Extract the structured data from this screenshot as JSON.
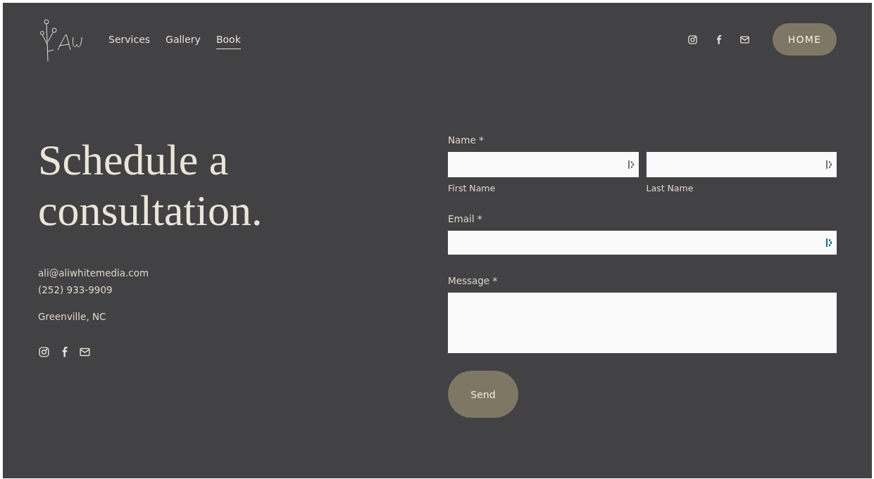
{
  "header": {
    "nav": [
      {
        "label": "Services",
        "selected": false
      },
      {
        "label": "Gallery",
        "selected": false
      },
      {
        "label": "Book",
        "selected": true
      }
    ],
    "social": [
      {
        "kind": "instagram"
      },
      {
        "kind": "facebook"
      },
      {
        "kind": "email"
      }
    ],
    "home_button": "HOME"
  },
  "contact": {
    "heading": "Schedule a consultation.",
    "email": "ali@aliwhitemedia.com",
    "phone": "(252) 933-9909",
    "location": "Greenville, NC",
    "social": [
      {
        "kind": "instagram"
      },
      {
        "kind": "facebook"
      },
      {
        "kind": "email"
      }
    ]
  },
  "form": {
    "name_label": "Name *",
    "name_fields": [
      {
        "caption": "First Name",
        "autofill_active": false
      },
      {
        "caption": "Last Name",
        "autofill_active": false
      }
    ],
    "email_label": "Email *",
    "email_field": {
      "autofill_active": true
    },
    "message_label": "Message *",
    "submit": "Send"
  }
}
